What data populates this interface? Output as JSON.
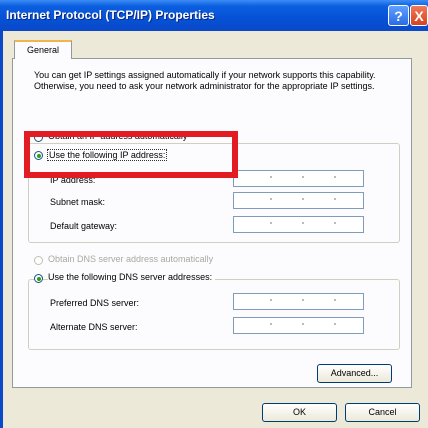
{
  "window": {
    "title": "Internet Protocol (TCP/IP) Properties",
    "help_label": "?",
    "close_label": "X"
  },
  "tabs": [
    {
      "label": "General",
      "selected": true
    }
  ],
  "description": "You can get IP settings assigned automatically if your network supports this capability. Otherwise, you need to ask your network administrator for the appropriate IP settings.",
  "ip_section": {
    "auto_option": {
      "label": "Obtain an IP address automatically",
      "selected": false
    },
    "manual_option": {
      "label": "Use the following IP address:",
      "selected": true
    },
    "fields": [
      {
        "label": "IP address:",
        "value": ""
      },
      {
        "label": "Subnet mask:",
        "value": ""
      },
      {
        "label": "Default gateway:",
        "value": ""
      }
    ]
  },
  "dns_section": {
    "auto_option": {
      "label": "Obtain DNS server address automatically",
      "selected": false,
      "enabled": false
    },
    "manual_option": {
      "label": "Use the following DNS server addresses:",
      "selected": true
    },
    "fields": [
      {
        "label": "Preferred DNS server:",
        "value": ""
      },
      {
        "label": "Alternate DNS server:",
        "value": ""
      }
    ]
  },
  "buttons": {
    "advanced": "Advanced...",
    "ok": "OK",
    "cancel": "Cancel"
  },
  "colors": {
    "title_bar": "#0651d6",
    "highlight_box": "#e31b23",
    "dialog_bg": "#ece9d8"
  }
}
